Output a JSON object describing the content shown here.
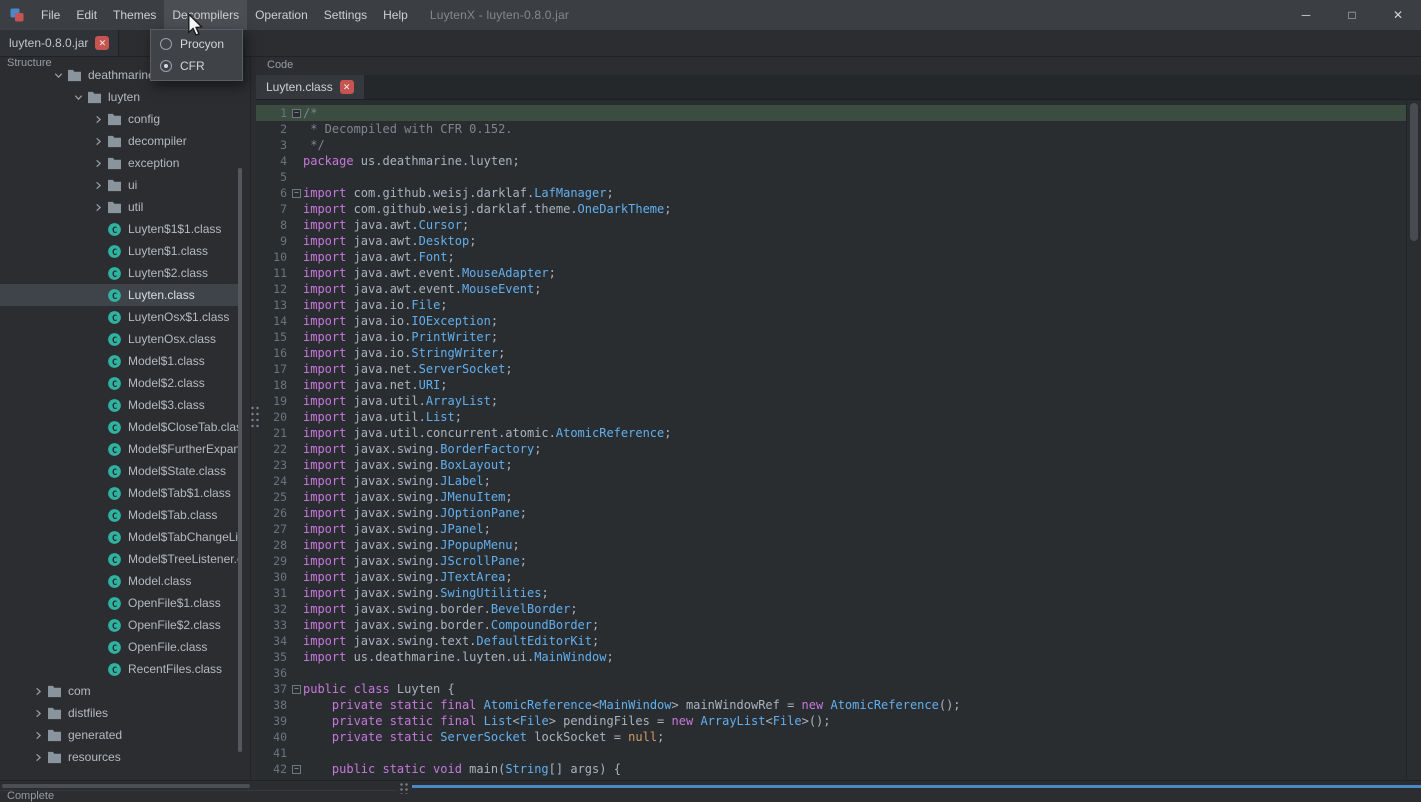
{
  "window": {
    "app_title": "LuytenX - luyten-0.8.0.jar",
    "controls": {
      "minimize": "─",
      "maximize": "□",
      "close": "✕"
    }
  },
  "menubar": {
    "items": [
      {
        "label": "File"
      },
      {
        "label": "Edit"
      },
      {
        "label": "Themes"
      },
      {
        "label": "Decompilers",
        "open": true
      },
      {
        "label": "Operation"
      },
      {
        "label": "Settings"
      },
      {
        "label": "Help"
      }
    ]
  },
  "decompilers_menu": {
    "items": [
      {
        "label": "Procyon",
        "selected": false
      },
      {
        "label": "CFR",
        "selected": true
      }
    ]
  },
  "jar_tab": {
    "label": "luyten-0.8.0.jar",
    "close": "✕"
  },
  "structure_panel": {
    "header": "Structure",
    "tree": [
      {
        "label": "deathmarine",
        "level": 2,
        "type": "folder",
        "expanded": true
      },
      {
        "label": "luyten",
        "level": 3,
        "type": "folder",
        "expanded": true
      },
      {
        "label": "config",
        "level": 4,
        "type": "folder",
        "expanded": false
      },
      {
        "label": "decompiler",
        "level": 4,
        "type": "folder",
        "expanded": false
      },
      {
        "label": "exception",
        "level": 4,
        "type": "folder",
        "expanded": false
      },
      {
        "label": "ui",
        "level": 4,
        "type": "folder",
        "expanded": false
      },
      {
        "label": "util",
        "level": 4,
        "type": "folder",
        "expanded": false
      },
      {
        "label": "Luyten$1$1.class",
        "level": 4,
        "type": "class"
      },
      {
        "label": "Luyten$1.class",
        "level": 4,
        "type": "class"
      },
      {
        "label": "Luyten$2.class",
        "level": 4,
        "type": "class"
      },
      {
        "label": "Luyten.class",
        "level": 4,
        "type": "class",
        "selected": true
      },
      {
        "label": "LuytenOsx$1.class",
        "level": 4,
        "type": "class"
      },
      {
        "label": "LuytenOsx.class",
        "level": 4,
        "type": "class"
      },
      {
        "label": "Model$1.class",
        "level": 4,
        "type": "class"
      },
      {
        "label": "Model$2.class",
        "level": 4,
        "type": "class"
      },
      {
        "label": "Model$3.class",
        "level": 4,
        "type": "class"
      },
      {
        "label": "Model$CloseTab.class",
        "level": 4,
        "type": "class"
      },
      {
        "label": "Model$FurtherExpandingTreeListener.class",
        "level": 4,
        "type": "class"
      },
      {
        "label": "Model$State.class",
        "level": 4,
        "type": "class"
      },
      {
        "label": "Model$Tab$1.class",
        "level": 4,
        "type": "class"
      },
      {
        "label": "Model$Tab.class",
        "level": 4,
        "type": "class"
      },
      {
        "label": "Model$TabChangeListener.class",
        "level": 4,
        "type": "class"
      },
      {
        "label": "Model$TreeListener.class",
        "level": 4,
        "type": "class"
      },
      {
        "label": "Model.class",
        "level": 4,
        "type": "class"
      },
      {
        "label": "OpenFile$1.class",
        "level": 4,
        "type": "class"
      },
      {
        "label": "OpenFile$2.class",
        "level": 4,
        "type": "class"
      },
      {
        "label": "OpenFile.class",
        "level": 4,
        "type": "class"
      },
      {
        "label": "RecentFiles.class",
        "level": 4,
        "type": "class"
      },
      {
        "label": "com",
        "level": 1,
        "type": "folder",
        "expanded": false
      },
      {
        "label": "distfiles",
        "level": 1,
        "type": "folder",
        "expanded": false
      },
      {
        "label": "generated",
        "level": 1,
        "type": "folder",
        "expanded": false
      },
      {
        "label": "resources",
        "level": 1,
        "type": "folder",
        "expanded": false
      }
    ]
  },
  "code_panel": {
    "header": "Code",
    "tab": {
      "label": "Luyten.class",
      "close": "✕"
    },
    "fold_glyph": "−",
    "lines": [
      {
        "n": 1,
        "fold": true,
        "hl": true,
        "seg": [
          [
            "c",
            "/*"
          ]
        ]
      },
      {
        "n": 2,
        "seg": [
          [
            "c",
            " * Decompiled with CFR 0.152."
          ]
        ]
      },
      {
        "n": 3,
        "seg": [
          [
            "c",
            " */"
          ]
        ]
      },
      {
        "n": 4,
        "seg": [
          [
            "k",
            "package"
          ],
          [
            "p",
            " us.deathmarine.luyten;"
          ]
        ]
      },
      {
        "n": 5,
        "seg": []
      },
      {
        "n": 6,
        "fold": true,
        "seg": [
          [
            "k",
            "import"
          ],
          [
            "p",
            " com.github.weisj.darklaf."
          ],
          [
            "t",
            "LafManager"
          ],
          [
            "p",
            ";"
          ]
        ]
      },
      {
        "n": 7,
        "seg": [
          [
            "k",
            "import"
          ],
          [
            "p",
            " com.github.weisj.darklaf.theme."
          ],
          [
            "t",
            "OneDarkTheme"
          ],
          [
            "p",
            ";"
          ]
        ]
      },
      {
        "n": 8,
        "seg": [
          [
            "k",
            "import"
          ],
          [
            "p",
            " java.awt."
          ],
          [
            "t",
            "Cursor"
          ],
          [
            "p",
            ";"
          ]
        ]
      },
      {
        "n": 9,
        "seg": [
          [
            "k",
            "import"
          ],
          [
            "p",
            " java.awt."
          ],
          [
            "t",
            "Desktop"
          ],
          [
            "p",
            ";"
          ]
        ]
      },
      {
        "n": 10,
        "seg": [
          [
            "k",
            "import"
          ],
          [
            "p",
            " java.awt."
          ],
          [
            "t",
            "Font"
          ],
          [
            "p",
            ";"
          ]
        ]
      },
      {
        "n": 11,
        "seg": [
          [
            "k",
            "import"
          ],
          [
            "p",
            " java.awt.event."
          ],
          [
            "t",
            "MouseAdapter"
          ],
          [
            "p",
            ";"
          ]
        ]
      },
      {
        "n": 12,
        "seg": [
          [
            "k",
            "import"
          ],
          [
            "p",
            " java.awt.event."
          ],
          [
            "t",
            "MouseEvent"
          ],
          [
            "p",
            ";"
          ]
        ]
      },
      {
        "n": 13,
        "seg": [
          [
            "k",
            "import"
          ],
          [
            "p",
            " java.io."
          ],
          [
            "t",
            "File"
          ],
          [
            "p",
            ";"
          ]
        ]
      },
      {
        "n": 14,
        "seg": [
          [
            "k",
            "import"
          ],
          [
            "p",
            " java.io."
          ],
          [
            "t",
            "IOException"
          ],
          [
            "p",
            ";"
          ]
        ]
      },
      {
        "n": 15,
        "seg": [
          [
            "k",
            "import"
          ],
          [
            "p",
            " java.io."
          ],
          [
            "t",
            "PrintWriter"
          ],
          [
            "p",
            ";"
          ]
        ]
      },
      {
        "n": 16,
        "seg": [
          [
            "k",
            "import"
          ],
          [
            "p",
            " java.io."
          ],
          [
            "t",
            "StringWriter"
          ],
          [
            "p",
            ";"
          ]
        ]
      },
      {
        "n": 17,
        "seg": [
          [
            "k",
            "import"
          ],
          [
            "p",
            " java.net."
          ],
          [
            "t",
            "ServerSocket"
          ],
          [
            "p",
            ";"
          ]
        ]
      },
      {
        "n": 18,
        "seg": [
          [
            "k",
            "import"
          ],
          [
            "p",
            " java.net."
          ],
          [
            "t",
            "URI"
          ],
          [
            "p",
            ";"
          ]
        ]
      },
      {
        "n": 19,
        "seg": [
          [
            "k",
            "import"
          ],
          [
            "p",
            " java.util."
          ],
          [
            "t",
            "ArrayList"
          ],
          [
            "p",
            ";"
          ]
        ]
      },
      {
        "n": 20,
        "seg": [
          [
            "k",
            "import"
          ],
          [
            "p",
            " java.util."
          ],
          [
            "t",
            "List"
          ],
          [
            "p",
            ";"
          ]
        ]
      },
      {
        "n": 21,
        "seg": [
          [
            "k",
            "import"
          ],
          [
            "p",
            " java.util.concurrent.atomic."
          ],
          [
            "t",
            "AtomicReference"
          ],
          [
            "p",
            ";"
          ]
        ]
      },
      {
        "n": 22,
        "seg": [
          [
            "k",
            "import"
          ],
          [
            "p",
            " javax.swing."
          ],
          [
            "t",
            "BorderFactory"
          ],
          [
            "p",
            ";"
          ]
        ]
      },
      {
        "n": 23,
        "seg": [
          [
            "k",
            "import"
          ],
          [
            "p",
            " javax.swing."
          ],
          [
            "t",
            "BoxLayout"
          ],
          [
            "p",
            ";"
          ]
        ]
      },
      {
        "n": 24,
        "seg": [
          [
            "k",
            "import"
          ],
          [
            "p",
            " javax.swing."
          ],
          [
            "t",
            "JLabel"
          ],
          [
            "p",
            ";"
          ]
        ]
      },
      {
        "n": 25,
        "seg": [
          [
            "k",
            "import"
          ],
          [
            "p",
            " javax.swing."
          ],
          [
            "t",
            "JMenuItem"
          ],
          [
            "p",
            ";"
          ]
        ]
      },
      {
        "n": 26,
        "seg": [
          [
            "k",
            "import"
          ],
          [
            "p",
            " javax.swing."
          ],
          [
            "t",
            "JOptionPane"
          ],
          [
            "p",
            ";"
          ]
        ]
      },
      {
        "n": 27,
        "seg": [
          [
            "k",
            "import"
          ],
          [
            "p",
            " javax.swing."
          ],
          [
            "t",
            "JPanel"
          ],
          [
            "p",
            ";"
          ]
        ]
      },
      {
        "n": 28,
        "seg": [
          [
            "k",
            "import"
          ],
          [
            "p",
            " javax.swing."
          ],
          [
            "t",
            "JPopupMenu"
          ],
          [
            "p",
            ";"
          ]
        ]
      },
      {
        "n": 29,
        "seg": [
          [
            "k",
            "import"
          ],
          [
            "p",
            " javax.swing."
          ],
          [
            "t",
            "JScrollPane"
          ],
          [
            "p",
            ";"
          ]
        ]
      },
      {
        "n": 30,
        "seg": [
          [
            "k",
            "import"
          ],
          [
            "p",
            " javax.swing."
          ],
          [
            "t",
            "JTextArea"
          ],
          [
            "p",
            ";"
          ]
        ]
      },
      {
        "n": 31,
        "seg": [
          [
            "k",
            "import"
          ],
          [
            "p",
            " javax.swing."
          ],
          [
            "t",
            "SwingUtilities"
          ],
          [
            "p",
            ";"
          ]
        ]
      },
      {
        "n": 32,
        "seg": [
          [
            "k",
            "import"
          ],
          [
            "p",
            " javax.swing.border."
          ],
          [
            "t",
            "BevelBorder"
          ],
          [
            "p",
            ";"
          ]
        ]
      },
      {
        "n": 33,
        "seg": [
          [
            "k",
            "import"
          ],
          [
            "p",
            " javax.swing.border."
          ],
          [
            "t",
            "CompoundBorder"
          ],
          [
            "p",
            ";"
          ]
        ]
      },
      {
        "n": 34,
        "seg": [
          [
            "k",
            "import"
          ],
          [
            "p",
            " javax.swing.text."
          ],
          [
            "t",
            "DefaultEditorKit"
          ],
          [
            "p",
            ";"
          ]
        ]
      },
      {
        "n": 35,
        "seg": [
          [
            "k",
            "import"
          ],
          [
            "p",
            " us.deathmarine.luyten.ui."
          ],
          [
            "t",
            "MainWindow"
          ],
          [
            "p",
            ";"
          ]
        ]
      },
      {
        "n": 36,
        "seg": []
      },
      {
        "n": 37,
        "fold": true,
        "seg": [
          [
            "k",
            "public class"
          ],
          [
            "p",
            " Luyten {"
          ]
        ]
      },
      {
        "n": 38,
        "seg": [
          [
            "p",
            "    "
          ],
          [
            "k",
            "private static final"
          ],
          [
            "p",
            " "
          ],
          [
            "t",
            "AtomicReference"
          ],
          [
            "p",
            "<"
          ],
          [
            "t",
            "MainWindow"
          ],
          [
            "p",
            "> mainWindowRef = "
          ],
          [
            "k",
            "new"
          ],
          [
            "p",
            " "
          ],
          [
            "t",
            "AtomicReference"
          ],
          [
            "p",
            "();"
          ]
        ]
      },
      {
        "n": 39,
        "seg": [
          [
            "p",
            "    "
          ],
          [
            "k",
            "private static final"
          ],
          [
            "p",
            " "
          ],
          [
            "t",
            "List"
          ],
          [
            "p",
            "<"
          ],
          [
            "t",
            "File"
          ],
          [
            "p",
            "> pendingFiles = "
          ],
          [
            "k",
            "new"
          ],
          [
            "p",
            " "
          ],
          [
            "t",
            "ArrayList"
          ],
          [
            "p",
            "<"
          ],
          [
            "t",
            "File"
          ],
          [
            "p",
            ">();"
          ]
        ]
      },
      {
        "n": 40,
        "seg": [
          [
            "p",
            "    "
          ],
          [
            "k",
            "private static"
          ],
          [
            "p",
            " "
          ],
          [
            "t",
            "ServerSocket"
          ],
          [
            "p",
            " lockSocket = "
          ],
          [
            "n",
            "null"
          ],
          [
            "p",
            ";"
          ]
        ]
      },
      {
        "n": 41,
        "seg": []
      },
      {
        "n": 42,
        "fold": true,
        "seg": [
          [
            "p",
            "    "
          ],
          [
            "k",
            "public static void"
          ],
          [
            "p",
            " main("
          ],
          [
            "t",
            "String"
          ],
          [
            "p",
            "[] args) {"
          ]
        ]
      }
    ]
  },
  "statusbar": {
    "label": "Complete"
  },
  "colors": {
    "progress_accent": "#4a88c7",
    "close_badge": "#c75450",
    "selection": "#3f444a",
    "line_highlight": "#3b4c41",
    "class_icon": "#2fb3a0",
    "folder_icon": "#8a949c",
    "syntax": {
      "k": "#c678dd",
      "t": "#61afef",
      "p": "#abb2bf",
      "c": "#7f848e",
      "n": "#d19a66"
    }
  }
}
